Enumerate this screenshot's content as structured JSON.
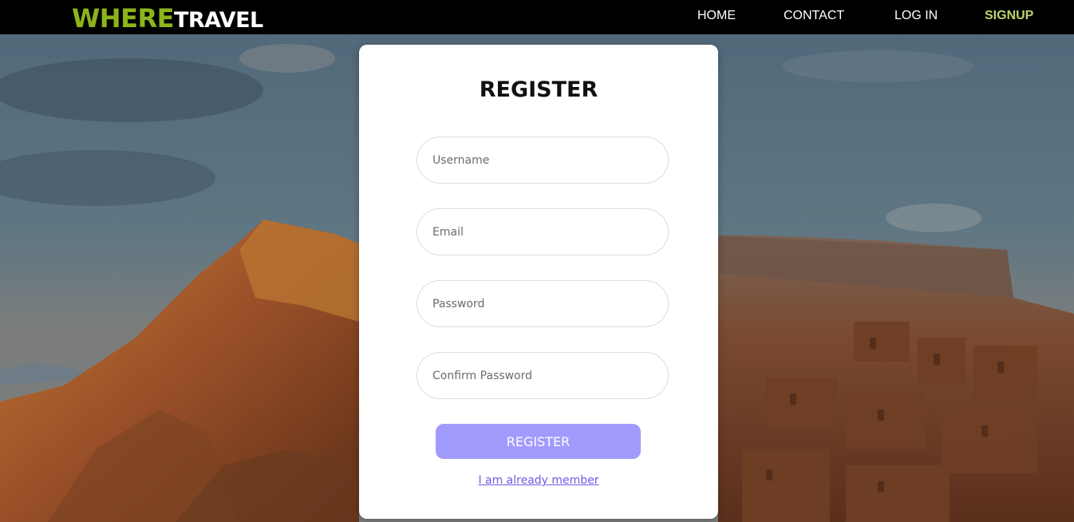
{
  "brand": {
    "part1": "WHERE",
    "part2": "TRAVEL"
  },
  "nav": {
    "home": "HOME",
    "contact": "CONTACT",
    "login": "LOG IN",
    "signup": "SIGNUP"
  },
  "form": {
    "title": "REGISTER",
    "username_placeholder": "Username",
    "email_placeholder": "Email",
    "password_placeholder": "Password",
    "confirm_placeholder": "Confirm Password",
    "submit_label": "REGISTER",
    "member_link": "I am already member"
  },
  "colors": {
    "brand_green": "#8db51b",
    "nav_active": "#b9d36b",
    "button": "#a29bfe",
    "link": "#6c5ce7"
  }
}
